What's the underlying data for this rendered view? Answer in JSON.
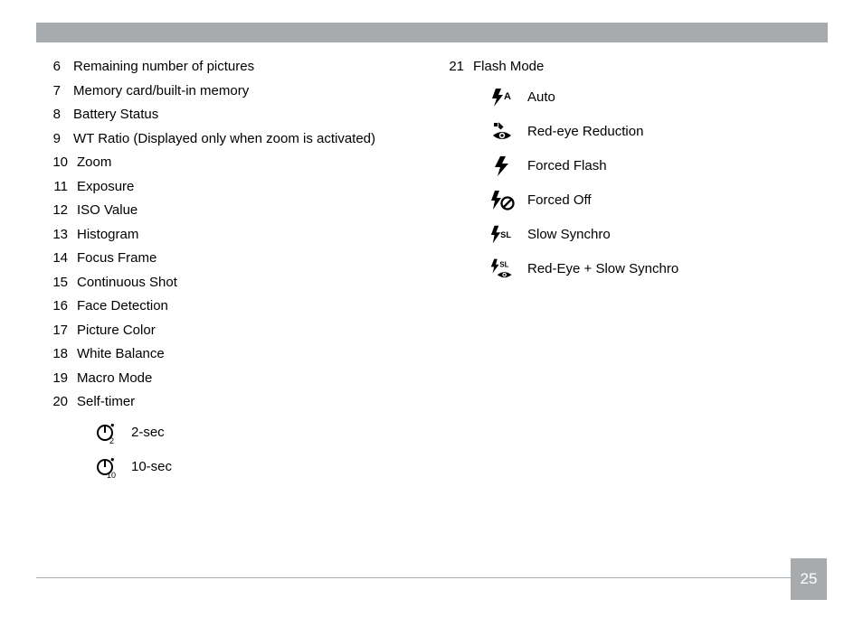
{
  "page_number": "25",
  "left_column": [
    {
      "num": "6",
      "label": "Remaining number of pictures"
    },
    {
      "num": "7",
      "label": "Memory card/built-in memory"
    },
    {
      "num": "8",
      "label": "Battery Status"
    },
    {
      "num": "9",
      "label": "WT Ratio (Displayed only when zoom is activated)"
    },
    {
      "num": "10",
      "label": "Zoom"
    },
    {
      "num": "11",
      "label": "Exposure"
    },
    {
      "num": "12",
      "label": "ISO Value"
    },
    {
      "num": "13",
      "label": "Histogram"
    },
    {
      "num": "14",
      "label": "Focus Frame"
    },
    {
      "num": "15",
      "label": "Continuous Shot"
    },
    {
      "num": "16",
      "label": "Face Detection"
    },
    {
      "num": "17",
      "label": "Picture Color"
    },
    {
      "num": "18",
      "label": "White Balance"
    },
    {
      "num": "19",
      "label": "Macro Mode"
    },
    {
      "num": "20",
      "label": "Self-timer"
    }
  ],
  "self_timer_options": [
    {
      "icon": "timer-2-icon",
      "label": "2-sec"
    },
    {
      "icon": "timer-10-icon",
      "label": "10-sec"
    }
  ],
  "right_column_header": {
    "num": "21",
    "label": "Flash Mode"
  },
  "flash_mode_options": [
    {
      "icon": "flash-auto-icon",
      "label": "Auto"
    },
    {
      "icon": "flash-red-eye-icon",
      "label": "Red-eye Reduction"
    },
    {
      "icon": "flash-forced-icon",
      "label": "Forced Flash"
    },
    {
      "icon": "flash-off-icon",
      "label": "Forced Off"
    },
    {
      "icon": "flash-slow-icon",
      "label": "Slow Synchro"
    },
    {
      "icon": "flash-red-eye-slow-icon",
      "label": "Red-Eye + Slow Synchro"
    }
  ]
}
